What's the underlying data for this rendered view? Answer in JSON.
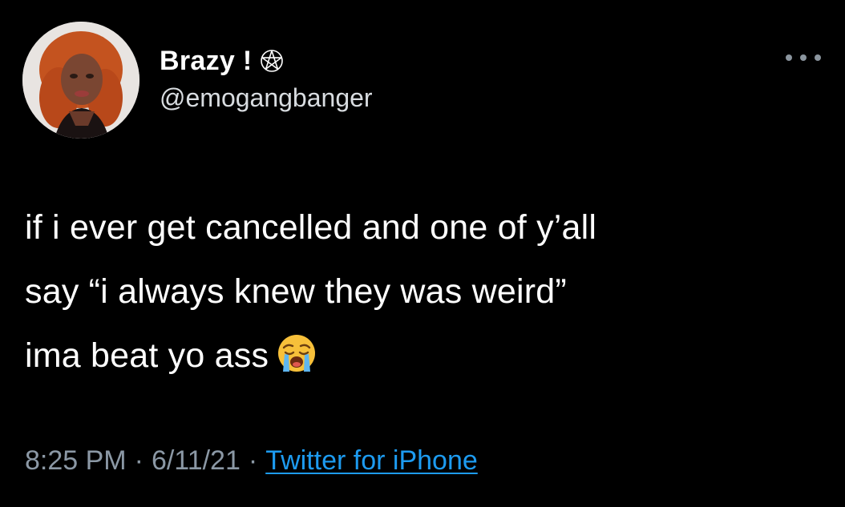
{
  "tweet": {
    "display_name": "Brazy !",
    "display_name_icon": "pentagram-icon",
    "handle": "@emogangbanger",
    "more_icon": "more-options-icon",
    "text_lines": [
      "if i ever get cancelled and one of y’all",
      "say “i always knew they was weird”",
      "ima beat yo ass"
    ],
    "emoji": "loudly-crying-face-icon",
    "time": "8:25 PM",
    "separator": "·",
    "date": "6/11/21",
    "source": "Twitter for iPhone"
  },
  "colors": {
    "background": "#000000",
    "primary_text": "#ffffff",
    "secondary_text": "#8b98a5",
    "link": "#1d9bf0"
  }
}
